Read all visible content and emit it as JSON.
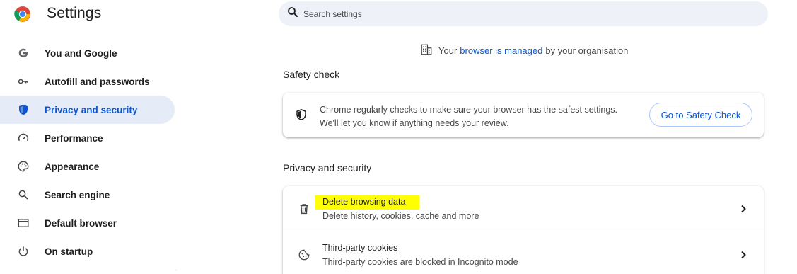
{
  "header": {
    "title": "Settings",
    "logo_icon": "chrome-logo-icon"
  },
  "search": {
    "placeholder": "Search settings",
    "icon": "search-icon"
  },
  "sidebar": {
    "items": [
      {
        "label": "You and Google",
        "icon": "google-g-icon",
        "active": false
      },
      {
        "label": "Autofill and passwords",
        "icon": "key-icon",
        "active": false
      },
      {
        "label": "Privacy and security",
        "icon": "shield-icon",
        "active": true
      },
      {
        "label": "Performance",
        "icon": "speedometer-icon",
        "active": false
      },
      {
        "label": "Appearance",
        "icon": "palette-icon",
        "active": false
      },
      {
        "label": "Search engine",
        "icon": "search-icon",
        "active": false
      },
      {
        "label": "Default browser",
        "icon": "browser-window-icon",
        "active": false
      },
      {
        "label": "On startup",
        "icon": "power-icon",
        "active": false
      }
    ]
  },
  "managed": {
    "prefix": "Your",
    "link": "browser is managed",
    "suffix": "by your organisation",
    "icon": "building-icon"
  },
  "safety_check": {
    "heading": "Safety check",
    "line1": "Chrome regularly checks to make sure your browser has the safest settings.",
    "line2": "We'll let you know if anything needs your review.",
    "button": "Go to Safety Check",
    "icon": "shield-icon"
  },
  "privacy": {
    "heading": "Privacy and security",
    "rows": [
      {
        "title": "Delete browsing data",
        "subtitle": "Delete history, cookies, cache and more",
        "icon": "trash-icon",
        "highlighted": true
      },
      {
        "title": "Third-party cookies",
        "subtitle": "Third-party cookies are blocked in Incognito mode",
        "icon": "cookie-icon",
        "highlighted": false
      }
    ]
  },
  "colors": {
    "accent": "#0b57d0",
    "active_bg": "#e6ecf7",
    "search_bg": "#eef1f8",
    "highlight": "#ffff00"
  }
}
